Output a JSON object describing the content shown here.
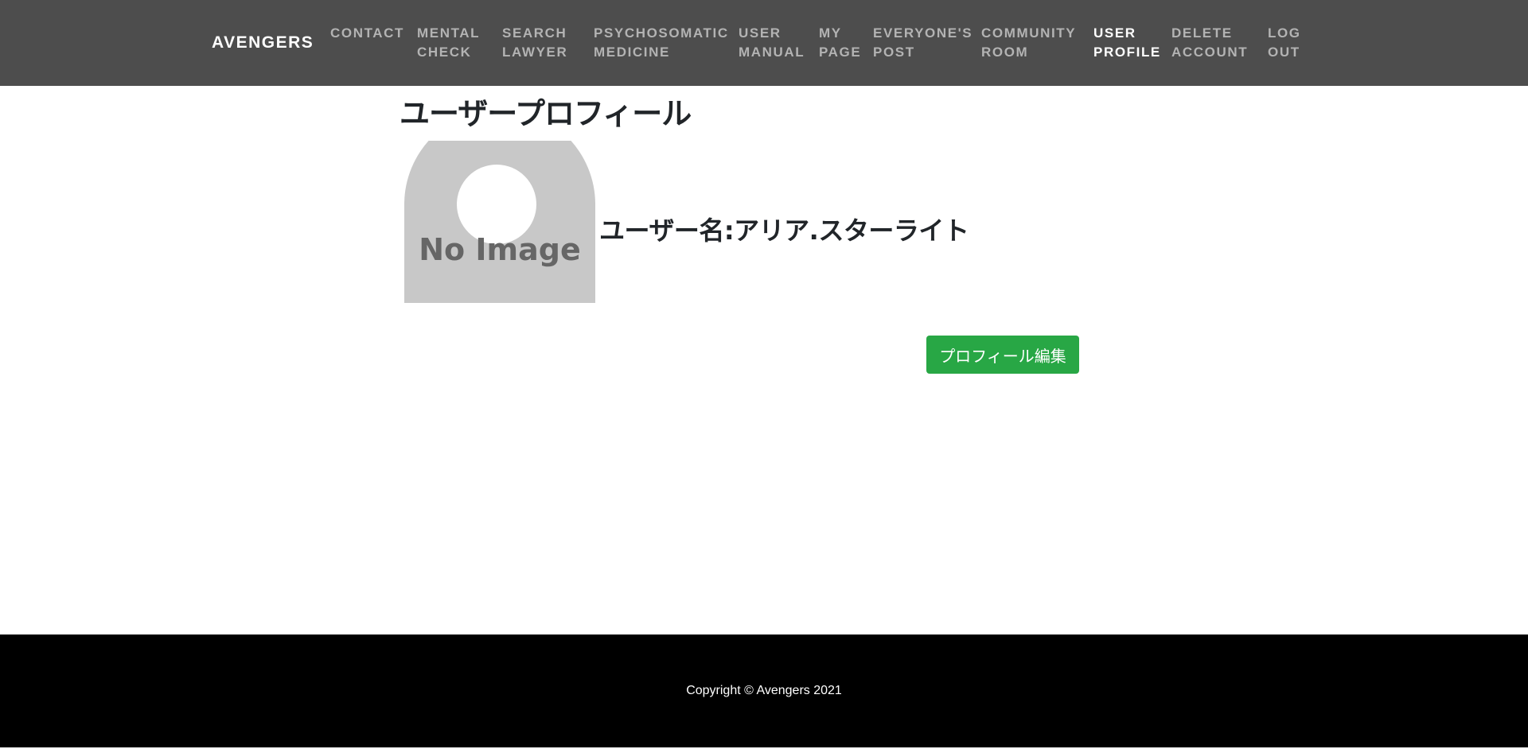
{
  "navbar": {
    "brand": "AVENGERS",
    "items": [
      {
        "line1": "CONTACT",
        "line2": ""
      },
      {
        "line1": "MENTAL",
        "line2": "CHECK"
      },
      {
        "line1": "SEARCH",
        "line2": "LAWYER"
      },
      {
        "line1": "PSYCHOSOMATIC",
        "line2": "MEDICINE"
      },
      {
        "line1": "USER",
        "line2": "MANUAL"
      },
      {
        "line1": "MY",
        "line2": "PAGE"
      },
      {
        "line1": "EVERYONE'S",
        "line2": "POST"
      },
      {
        "line1": "COMMUNITY",
        "line2": "ROOM"
      },
      {
        "line1": "USER",
        "line2": "PROFILE"
      },
      {
        "line1": "DELETE",
        "line2": "ACCOUNT"
      },
      {
        "line1": "LOG",
        "line2": "OUT"
      }
    ],
    "active_index": 8
  },
  "main": {
    "title": "ユーザープロフィール",
    "avatar_text": "No Image",
    "username": "ユーザー名:アリア.スターライト",
    "edit_button": "プロフィール編集"
  },
  "footer": {
    "copyright": "Copyright © Avengers 2021"
  },
  "colors": {
    "navbar_bg": "#4d4d4d",
    "nav_text": "#b3b3b3",
    "nav_active": "#ffffff",
    "button_bg": "#28a745",
    "footer_bg": "#000000"
  }
}
